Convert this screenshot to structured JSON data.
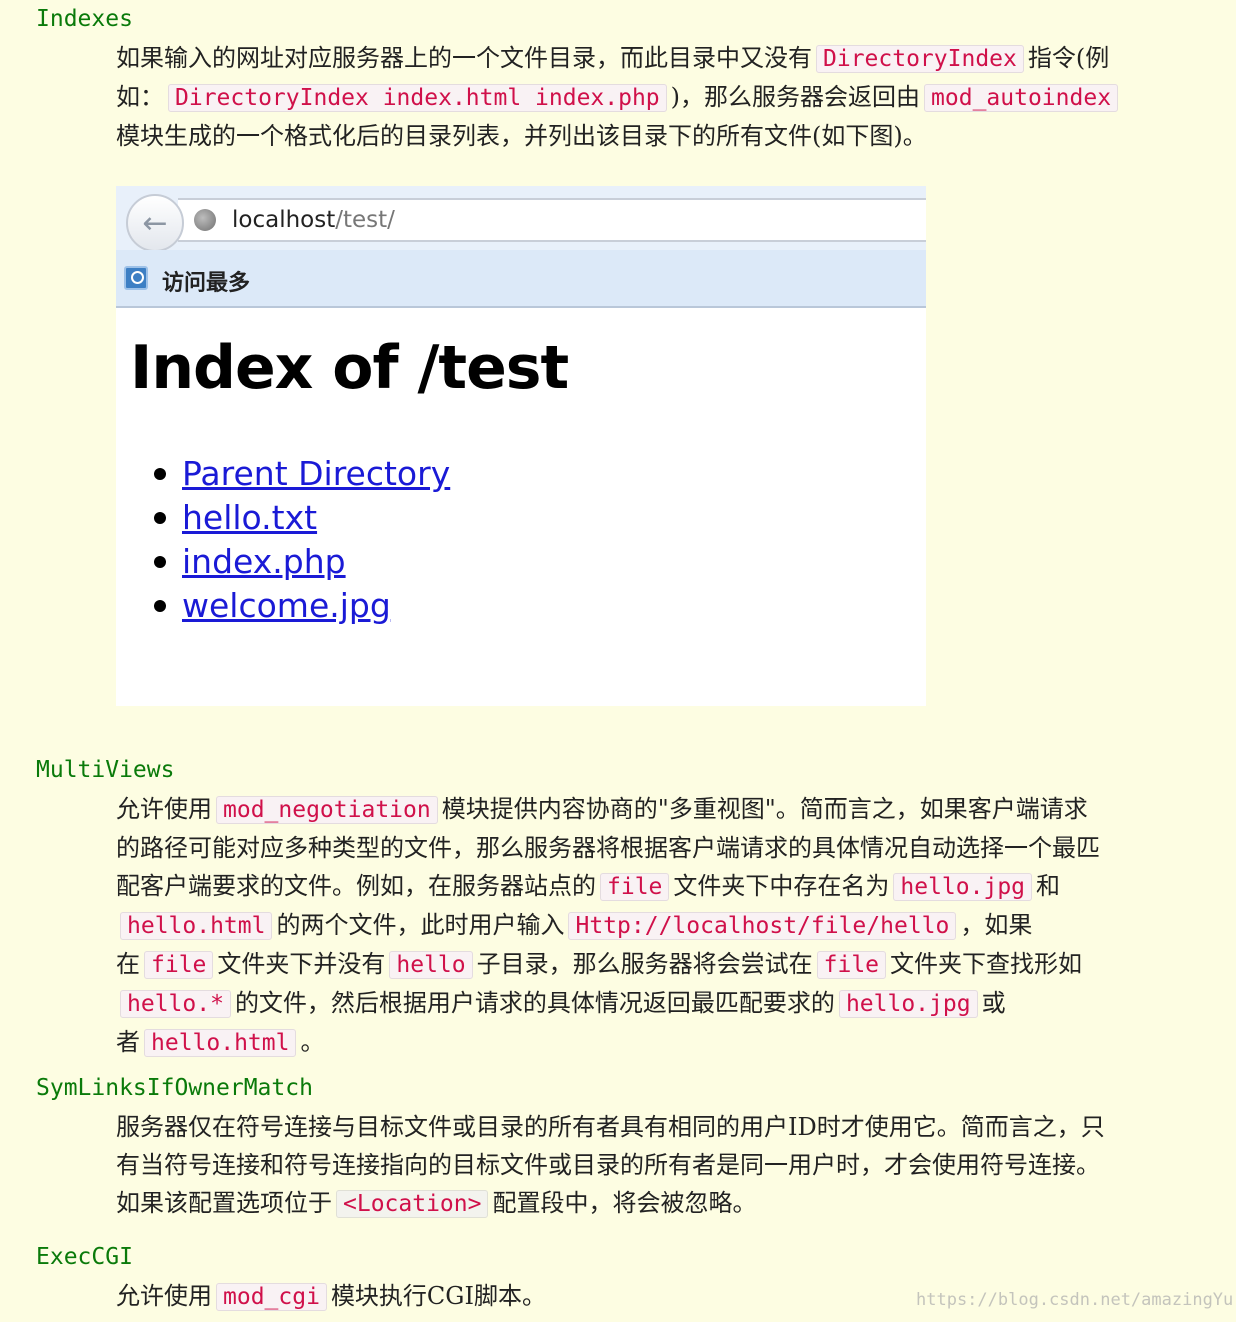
{
  "sections": {
    "indexes": {
      "term": "Indexes",
      "t1": "如果输入的网址对应服务器上的一个文件目录，而此目录中又没有",
      "c1": "DirectoryIndex",
      "t2": "指令(例",
      "t3": "如：",
      "c2": "DirectoryIndex index.html index.php",
      "t4": ")，那么服务器会返回由",
      "c3": "mod_autoindex",
      "t5": "模块生成的一个格式化后的目录列表，并列出该目录下的所有文件(如下图)。"
    },
    "multiviews": {
      "term": "MultiViews",
      "t1": "允许使用",
      "c1": "mod_negotiation",
      "t2": "模块提供内容协商的\"多重视图\"。简而言之，如果客户端请求",
      "t3": "的路径可能对应多种类型的文件，那么服务器将根据客户端请求的具体情况自动选择一个最匹",
      "t4": "配客户端要求的文件。例如，在服务器站点的",
      "c2": "file",
      "t5": "文件夹下中存在名为",
      "c3": "hello.jpg",
      "t6": "和",
      "c4": "hello.html",
      "t7": "的两个文件，此时用户输入",
      "c5": "Http://localhost/file/hello",
      "t8": "，如果",
      "t9": "在",
      "c6": "file",
      "t10": "文件夹下并没有",
      "c7": "hello",
      "t11": "子目录，那么服务器将会尝试在",
      "c8": "file",
      "t12": "文件夹下查找形如",
      "c9": "hello.*",
      "t13": "的文件，然后根据用户请求的具体情况返回最匹配要求的",
      "c10": "hello.jpg",
      "t14": "或",
      "t15": "者",
      "c11": "hello.html",
      "t16": "。"
    },
    "symlinks": {
      "term": "SymLinksIfOwnerMatch",
      "t1": "服务器仅在符号连接与目标文件或目录的所有者具有相同的用户ID时才使用它。简而言之，只",
      "t2": "有当符号连接和符号连接指向的目标文件或目录的所有者是同一用户时，才会使用符号连接。",
      "t3": "如果该配置选项位于",
      "c1": "<Location>",
      "t4": "配置段中，将会被忽略。"
    },
    "execcgi": {
      "term": "ExecCGI",
      "t1": "允许使用",
      "c1": "mod_cgi",
      "t2": "模块执行CGI脚本。"
    }
  },
  "browser": {
    "url_host": "localhost",
    "url_path": "/test/",
    "bookmark_label": "访问最多",
    "index_title": "Index of /test",
    "links": [
      "Parent Directory",
      "hello.txt",
      "index.php",
      "welcome.jpg"
    ]
  },
  "watermark": "https://blog.csdn.net/amazingYu",
  "colors": {
    "background": "#fdfde2",
    "term": "#0a7a0a",
    "code_text": "#d0104a",
    "link": "#1a1ad6"
  }
}
